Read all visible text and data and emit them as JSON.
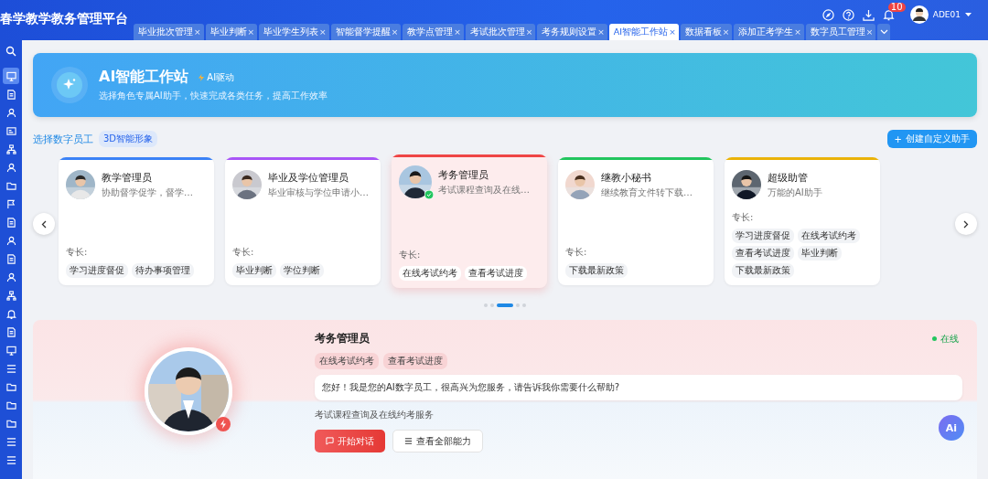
{
  "app_title": "春学教学教务管理平台",
  "tabs": [
    {
      "label": "毕业批次管理",
      "selected": false
    },
    {
      "label": "毕业判断",
      "selected": false
    },
    {
      "label": "毕业学生列表",
      "selected": false
    },
    {
      "label": "智能督学提醒",
      "selected": false
    },
    {
      "label": "教学点管理",
      "selected": false
    },
    {
      "label": "考试批次管理",
      "selected": false
    },
    {
      "label": "考务规则设置",
      "selected": false
    },
    {
      "label": "AI智能工作站",
      "selected": true
    },
    {
      "label": "数据看板",
      "selected": false
    },
    {
      "label": "添加正考学生",
      "selected": false
    },
    {
      "label": "数字员工管理",
      "selected": false
    }
  ],
  "tab_close": "×",
  "notifications": {
    "count": "10"
  },
  "user": {
    "name": "ADE01"
  },
  "sidebar": {
    "items": [
      {
        "selected": true
      },
      {
        "selected": false
      },
      {
        "selected": false
      },
      {
        "selected": false
      },
      {
        "selected": false
      },
      {
        "selected": false
      },
      {
        "selected": false
      },
      {
        "selected": false
      },
      {
        "selected": false
      },
      {
        "selected": false
      },
      {
        "selected": false
      },
      {
        "selected": false
      },
      {
        "selected": false
      },
      {
        "selected": false
      },
      {
        "selected": false
      },
      {
        "selected": false
      },
      {
        "selected": false
      },
      {
        "selected": false
      },
      {
        "selected": false
      },
      {
        "selected": false
      },
      {
        "selected": false
      },
      {
        "selected": false
      }
    ]
  },
  "banner": {
    "title": "AI智能工作站",
    "badge": "AI驱动",
    "subtitle": "选择角色专属AI助手，快速完成各类任务，提高工作效率"
  },
  "section": {
    "title": "选择数字员工",
    "badge": "3D智能形象",
    "create_button": "创建自定义助手",
    "create_icon": "+"
  },
  "employees": [
    {
      "name": "教学管理员",
      "desc": "协助督学促学，督学…",
      "color": "#3b82f6",
      "selected": false,
      "specialty_label": "专长:",
      "tags": [
        "学习进度督促",
        "待办事项管理"
      ]
    },
    {
      "name": "毕业及学位管理员",
      "desc": "毕业审核与学位申请小…",
      "color": "#a855f7",
      "selected": false,
      "specialty_label": "专长:",
      "tags": [
        "毕业判断",
        "学位判断"
      ]
    },
    {
      "name": "考务管理员",
      "desc": "考试课程查询及在线…",
      "color": "#ef4444",
      "selected": true,
      "specialty_label": "专长:",
      "tags": [
        "在线考试约考",
        "查看考试进度"
      ]
    },
    {
      "name": "继教小秘书",
      "desc": "继续教育文件转下载…",
      "color": "#22c55e",
      "selected": false,
      "specialty_label": "专长:",
      "tags": [
        "下载最新政策"
      ]
    },
    {
      "name": "超级助管",
      "desc": "万能的AI助手",
      "color": "#eab308",
      "selected": false,
      "specialty_label": "专长:",
      "tags": [
        "学习进度督促",
        "在线考试约考",
        "查看考试进度",
        "毕业判断",
        "下载最新政策"
      ]
    }
  ],
  "pager": [
    {
      "selected": false
    },
    {
      "selected": false
    },
    {
      "selected": true
    },
    {
      "selected": false
    },
    {
      "selected": false
    }
  ],
  "detail": {
    "name": "考务管理员",
    "status": "在线",
    "tags": [
      "在线考试约考",
      "查看考试进度"
    ],
    "greeting": "您好！我是您的AI数字员工，很高兴为您服务，请告诉我你需要什么帮助?",
    "desc": "考试课程查询及在线约考服务",
    "start_button": "开始对话",
    "all_button": "查看全部能力"
  },
  "ai_fab": "Ai"
}
